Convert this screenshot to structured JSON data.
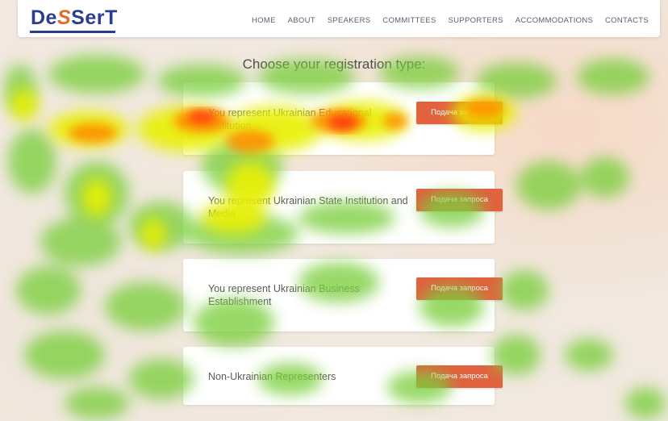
{
  "logo": {
    "part1": "De",
    "part2": "S",
    "part3": "SerT"
  },
  "nav": [
    "HOME",
    "ABOUT",
    "SPEAKERS",
    "COMMITTEES",
    "SUPPORTERS",
    "ACCOMMODATIONS",
    "CONTACTS"
  ],
  "heading": "Choose your registration type:",
  "cards": [
    {
      "label": "You represent Ukrainian Educational Institution",
      "button": "Подача запроса"
    },
    {
      "label": "You represent Ukrainian State Institution and Media",
      "button": "Подача запроса"
    },
    {
      "label": "You represent Ukrainian Business Establishment",
      "button": "Подача запроса"
    },
    {
      "label": "Non-Ukrainian Representers",
      "button": "Подача запроса"
    }
  ],
  "colors": {
    "brand_blue": "#2a3d8f",
    "brand_orange": "#e46a2a",
    "button": "#e0623e"
  }
}
